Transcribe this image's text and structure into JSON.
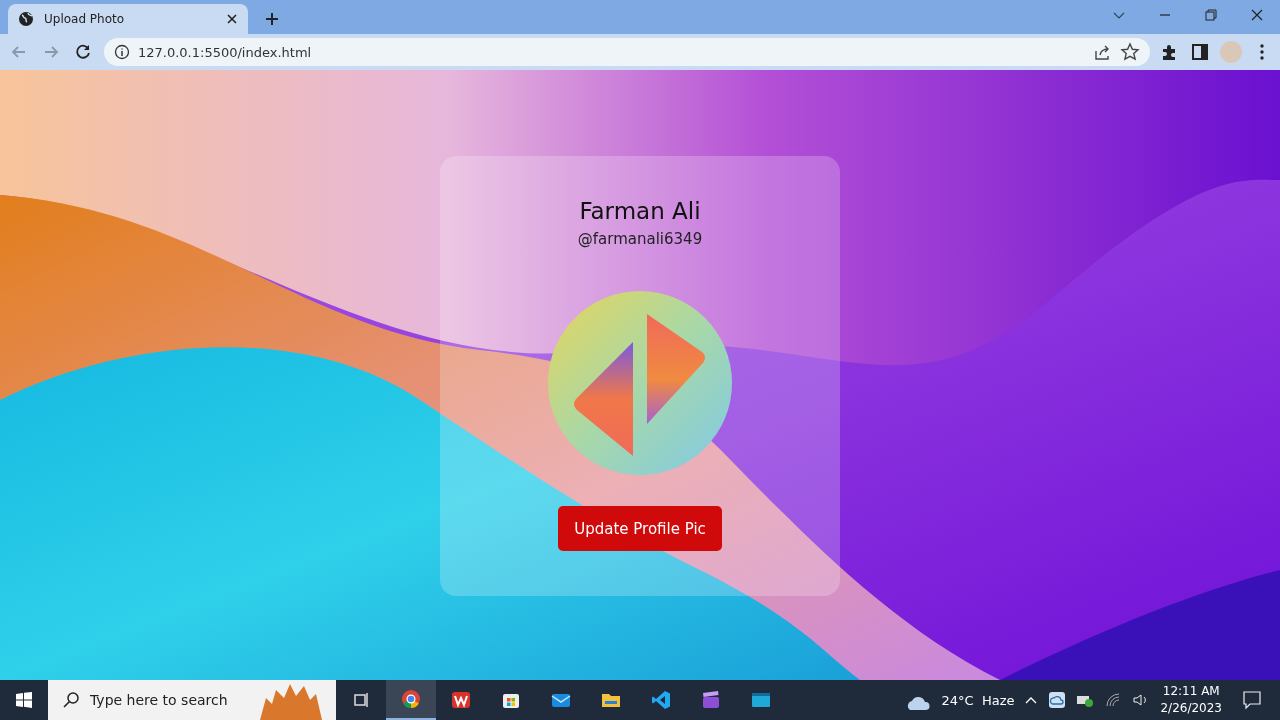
{
  "browser": {
    "tab": {
      "title": "Upload Photo"
    },
    "address": "127.0.0.1:5500/index.html"
  },
  "card": {
    "name": "Farman Ali",
    "handle": "@farmanali6349",
    "button": "Update Profile Pic"
  },
  "taskbar": {
    "search_placeholder": "Type here to search",
    "apps": [
      {
        "kind": "taskview",
        "selected": false
      },
      {
        "kind": "chrome",
        "selected": true
      },
      {
        "kind": "office",
        "selected": false
      },
      {
        "kind": "store",
        "selected": false
      },
      {
        "kind": "mail",
        "selected": false
      },
      {
        "kind": "files",
        "selected": false
      },
      {
        "kind": "vscode",
        "selected": false
      },
      {
        "kind": "clapper",
        "selected": false
      },
      {
        "kind": "window",
        "selected": false
      }
    ],
    "weather": "24°C  Haze",
    "time": "12:11 AM",
    "date": "2/26/2023"
  }
}
